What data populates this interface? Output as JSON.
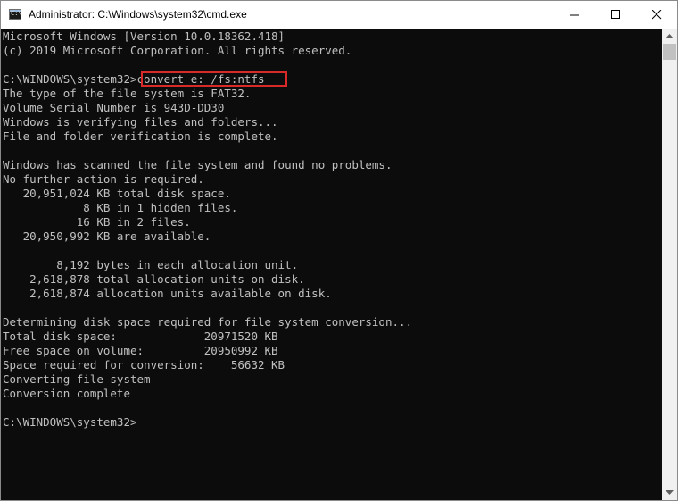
{
  "window": {
    "title": "Administrator: C:\\Windows\\system32\\cmd.exe",
    "icon": "cmd-icon",
    "icon_text": "C:\\",
    "controls": [
      "minimize-icon",
      "maximize-icon",
      "close-icon"
    ]
  },
  "console": {
    "lines": [
      "Microsoft Windows [Version 10.0.18362.418]",
      "(c) 2019 Microsoft Corporation. All rights reserved.",
      "",
      "C:\\WINDOWS\\system32>convert e: /fs:ntfs",
      "The type of the file system is FAT32.",
      "Volume Serial Number is 943D-DD30",
      "Windows is verifying files and folders...",
      "File and folder verification is complete.",
      "",
      "Windows has scanned the file system and found no problems.",
      "No further action is required.",
      "   20,951,024 KB total disk space.",
      "            8 KB in 1 hidden files.",
      "           16 KB in 2 files.",
      "   20,950,992 KB are available.",
      "",
      "        8,192 bytes in each allocation unit.",
      "    2,618,878 total allocation units on disk.",
      "    2,618,874 allocation units available on disk.",
      "",
      "Determining disk space required for file system conversion...",
      "Total disk space:             20971520 KB",
      "Free space on volume:         20950992 KB",
      "Space required for conversion:    56632 KB",
      "Converting file system",
      "Conversion complete",
      "",
      "C:\\WINDOWS\\system32>"
    ],
    "highlighted_command": "convert e: /fs:ntfs",
    "highlight_color": "#d92a2a",
    "text_color": "#c0c0c0",
    "background_color": "#0c0c0c"
  },
  "scrollbar": {
    "up_icon": "scroll-up-arrow-icon",
    "down_icon": "scroll-down-arrow-icon"
  }
}
